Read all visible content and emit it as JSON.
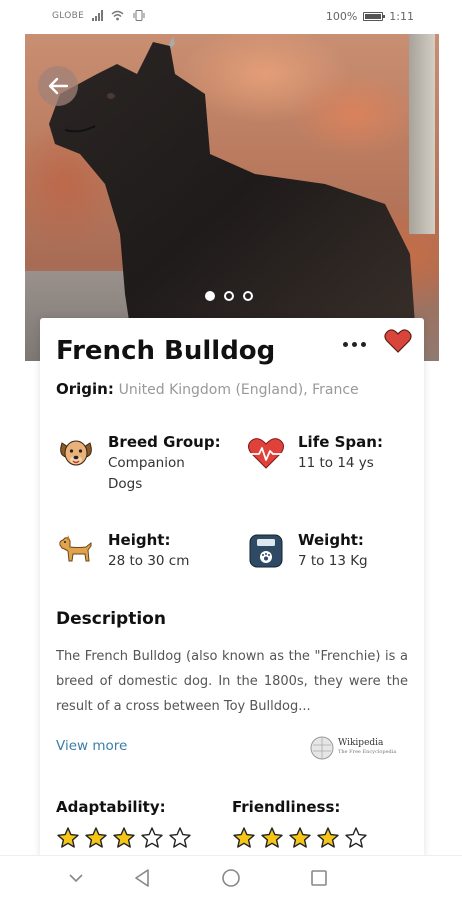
{
  "status_bar": {
    "carrier": "GLOBE",
    "battery_percent": "100%",
    "time": "1:11"
  },
  "hero": {
    "image_description": "dog-photo",
    "carousel": {
      "count": 3,
      "active_index": 0
    }
  },
  "breed": {
    "name": "French Bulldog",
    "origin_label": "Origin:",
    "origin_value": "United Kingdom (England), France",
    "favorited": true,
    "accent_color": "#d9453a"
  },
  "stats": {
    "breed_group": {
      "label": "Breed Group:",
      "line1": "Companion",
      "line2": "Dogs",
      "icon": "dog-face-icon"
    },
    "life_span": {
      "label": "Life Span:",
      "value": "11 to 14 ys",
      "icon": "heartbeat-icon"
    },
    "height": {
      "label": "Height:",
      "value": "28 to 30 cm",
      "icon": "dog-icon"
    },
    "weight": {
      "label": "Weight:",
      "value": "7 to 13 Kg",
      "icon": "scale-icon"
    }
  },
  "description": {
    "title": "Description",
    "text": "The French Bulldog (also known as the \"Frenchie) is a breed of domestic dog. In the 1800s, they were the result of a cross between Toy Bulldog...",
    "view_more": "View more",
    "source_logo": "Wikipedia",
    "source_tagline": "The Free Encyclopedia"
  },
  "ratings": {
    "adaptability": {
      "label": "Adaptability:",
      "value": 3,
      "max": 5
    },
    "friendliness": {
      "label": "Friendliness:",
      "value": 4,
      "max": 5
    }
  },
  "colors": {
    "star_fill": "#f5c518",
    "link": "#3d7ea6"
  }
}
